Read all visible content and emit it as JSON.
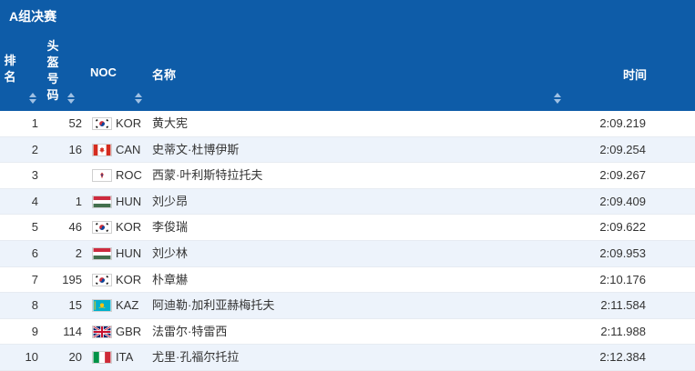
{
  "title": "A组决赛",
  "headers": {
    "rank": "排名",
    "bib": "头盔号码",
    "noc": "NOC",
    "name": "名称",
    "time": "时间"
  },
  "rows": [
    {
      "rank": "1",
      "bib": "52",
      "flag": "kor-flag-icon",
      "noc": "KOR",
      "name": "黄大宪",
      "time": "2:09.219"
    },
    {
      "rank": "2",
      "bib": "16",
      "flag": "can-flag-icon",
      "noc": "CAN",
      "name": "史蒂文·杜博伊斯",
      "time": "2:09.254"
    },
    {
      "rank": "3",
      "bib": "",
      "flag": "roc-flag-icon",
      "noc": "ROC",
      "name": "西蒙·叶利斯特拉托夫",
      "time": "2:09.267"
    },
    {
      "rank": "4",
      "bib": "1",
      "flag": "hun-flag-icon",
      "noc": "HUN",
      "name": "刘少昂",
      "time": "2:09.409"
    },
    {
      "rank": "5",
      "bib": "46",
      "flag": "kor-flag-icon",
      "noc": "KOR",
      "name": "李俊瑞",
      "time": "2:09.622"
    },
    {
      "rank": "6",
      "bib": "2",
      "flag": "hun-flag-icon",
      "noc": "HUN",
      "name": "刘少林",
      "time": "2:09.953"
    },
    {
      "rank": "7",
      "bib": "195",
      "flag": "kor-flag-icon",
      "noc": "KOR",
      "name": "朴章爀",
      "time": "2:10.176"
    },
    {
      "rank": "8",
      "bib": "15",
      "flag": "kaz-flag-icon",
      "noc": "KAZ",
      "name": "阿迪勒·加利亚赫梅托夫",
      "time": "2:11.584"
    },
    {
      "rank": "9",
      "bib": "114",
      "flag": "gbr-flag-icon",
      "noc": "GBR",
      "name": "法雷尔·特雷西",
      "time": "2:11.988"
    },
    {
      "rank": "10",
      "bib": "20",
      "flag": "ita-flag-icon",
      "noc": "ITA",
      "name": "尤里·孔福尔托拉",
      "time": "2:12.384"
    }
  ],
  "colors": {
    "header_bg": "#0e5ca8",
    "row_alt_bg": "#edf3fb"
  }
}
